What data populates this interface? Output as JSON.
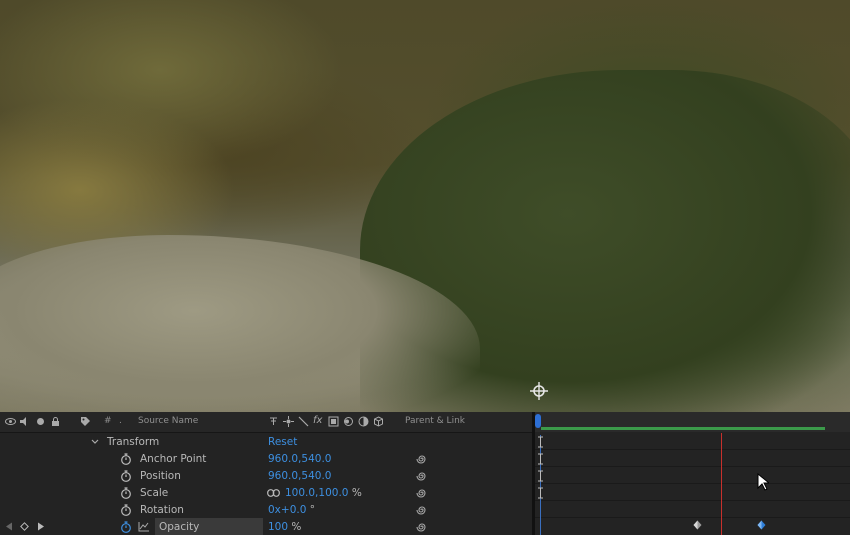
{
  "header": {
    "source_name": "Source Name",
    "parent_link": "Parent & Link",
    "hash_label": "#",
    "dot_label": ".",
    "fx_label": "fx"
  },
  "properties": {
    "group_label": "Transform",
    "reset_label": "Reset",
    "rows": [
      {
        "name": "Anchor Point",
        "value": "960.0,540.0",
        "unit": ""
      },
      {
        "name": "Position",
        "value": "960.0,540.0",
        "unit": ""
      },
      {
        "name": "Scale",
        "value": "100.0,100.0",
        "unit": "%"
      },
      {
        "name": "Rotation",
        "value": "0x+0.0",
        "unit": "°"
      },
      {
        "name": "Opacity",
        "value": "100",
        "unit": "%"
      }
    ]
  },
  "colors": {
    "value_blue": "#3d8fe0",
    "work_area_green": "#3b9a4a",
    "cti_red": "#c8302c"
  }
}
